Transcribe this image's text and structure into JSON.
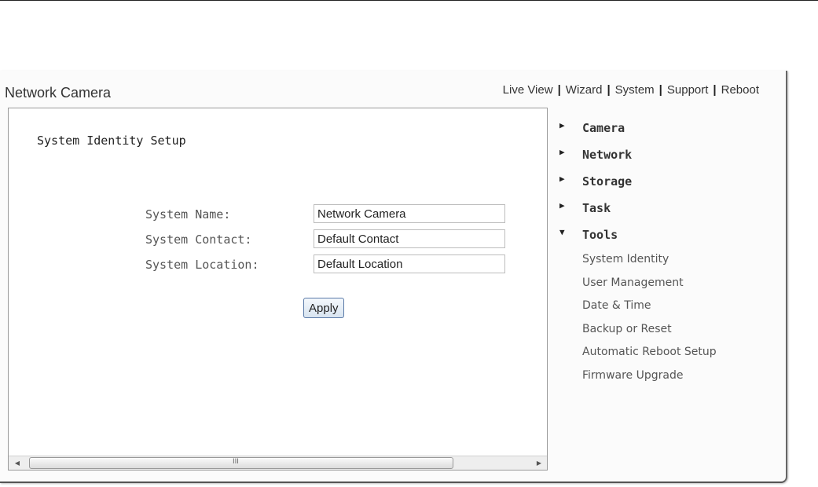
{
  "app": {
    "title": "Network Camera"
  },
  "topnav": {
    "links": [
      "Live View",
      "Wizard",
      "System",
      "Support",
      "Reboot"
    ],
    "separator": "|"
  },
  "form": {
    "section_title": "System Identity Setup",
    "fields": [
      {
        "label": "System Name:",
        "value": "Network Camera"
      },
      {
        "label": "System Contact:",
        "value": "Default Contact"
      },
      {
        "label": "System Location:",
        "value": "Default Location"
      }
    ],
    "apply_label": "Apply"
  },
  "sidebar": {
    "categories": [
      {
        "label": "Camera",
        "expanded": false,
        "icon": "triangle-right-icon"
      },
      {
        "label": "Network",
        "expanded": false,
        "icon": "triangle-right-icon"
      },
      {
        "label": "Storage",
        "expanded": false,
        "icon": "triangle-right-icon"
      },
      {
        "label": "Task",
        "expanded": false,
        "icon": "triangle-right-icon"
      },
      {
        "label": "Tools",
        "expanded": true,
        "icon": "triangle-down-icon"
      }
    ],
    "tools_items": [
      "System Identity",
      "User Management",
      "Date & Time",
      "Backup or Reset",
      "Automatic Reboot Setup",
      "Firmware Upgrade"
    ]
  },
  "scrollbar": {
    "left_arrow": "◀",
    "right_arrow": "▶",
    "grip": "III"
  },
  "colors": {
    "input_border": "#bdbdbd",
    "button_border": "#5a7aa8",
    "frame_border": "#9a9a9a"
  }
}
